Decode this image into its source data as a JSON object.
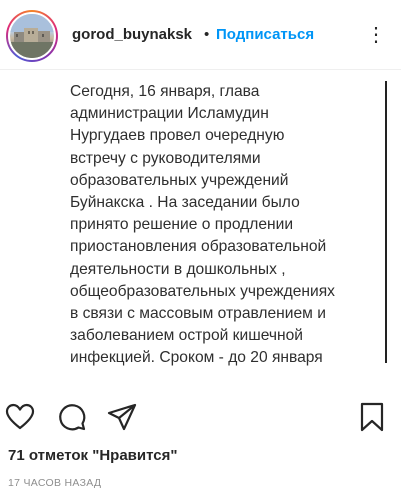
{
  "header": {
    "username": "gorod_buynaksk",
    "separator": "•",
    "follow_label": "Подписаться",
    "more_label": "⋮",
    "avatar_icon": "city-view-avatar"
  },
  "post": {
    "text": "Сегодня, 16 января, глава\nадминистрации Исламудин\nНургудаев провел очередную\nвстречу с руководителями\nобразовательных учреждений\nБуйнакска . На заседании было\nпринято решение о продлении\nприостановления образовательной\nдеятельности в дошкольных ,\nобщеобразовательных учреждениях\nв связи с массовым отравлением и\nзаболеванием острой кишечной\nинфекцией. Сроком - до 20 января"
  },
  "actions": {
    "like_icon": "heart-icon",
    "comment_icon": "comment-icon",
    "share_icon": "share-icon",
    "save_icon": "bookmark-icon"
  },
  "likes_label": "71 отметок \"Нравится\"",
  "timestamp": "17 ЧАСОВ НАЗАД",
  "colors": {
    "accent": "#0095f6",
    "text": "#262626",
    "muted": "#8e8e8e"
  }
}
